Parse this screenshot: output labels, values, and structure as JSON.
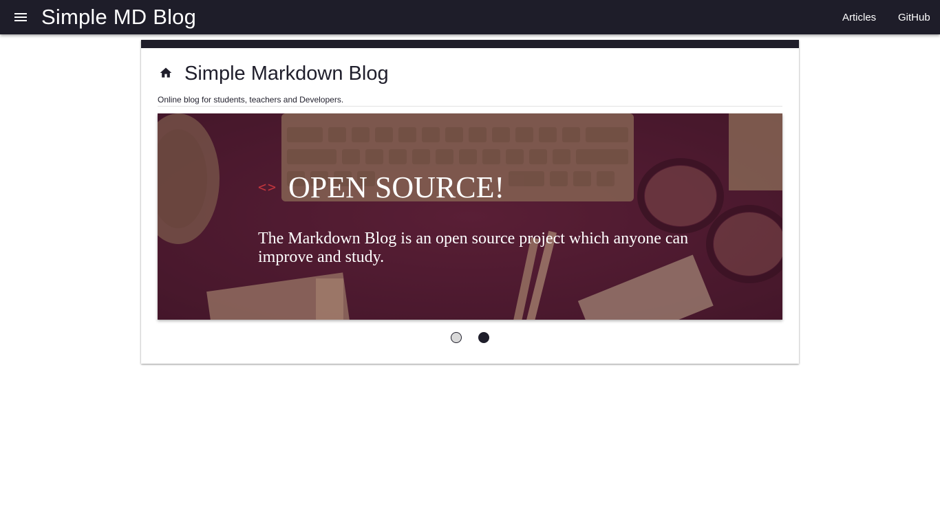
{
  "header": {
    "title": "Simple MD Blog",
    "menu_icon": "menu-icon",
    "nav": [
      {
        "label": "Articles"
      },
      {
        "label": "GitHub"
      }
    ]
  },
  "card": {
    "icon": "home-icon",
    "title": "Simple Markdown Blog",
    "subtitle": "Online blog for students, teachers and Developers."
  },
  "carousel": {
    "slide": {
      "icon": "code-icon",
      "icon_glyph": "<>",
      "heading": "OPEN SOURCE!",
      "text": "The Markdown Blog is an open source project which anyone can improve and study."
    },
    "slide_count": 2,
    "active_index": 1
  },
  "colors": {
    "primary": "#1e1d29",
    "slide_tint": "#4a1c2e",
    "code_icon": "#c0353d",
    "inactive_dot": "#d9d9d9"
  }
}
